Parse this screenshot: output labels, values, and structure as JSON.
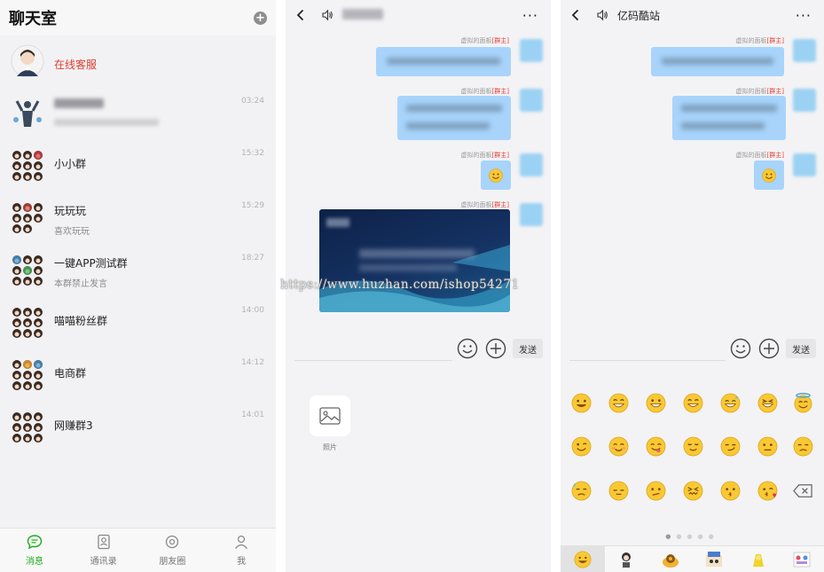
{
  "list_panel": {
    "title": "聊天室",
    "conversations": [
      {
        "name": "在线客服",
        "kind": "service"
      },
      {
        "name": "",
        "time": "03:24",
        "kind": "blurred"
      },
      {
        "name": "小小群",
        "time": "15:32",
        "kind": "group"
      },
      {
        "name": "玩玩玩",
        "time": "15:29",
        "sub": "喜欢玩玩",
        "kind": "group"
      },
      {
        "name": "一键APP测试群",
        "time": "18:27",
        "sub": "本群禁止发言",
        "kind": "group"
      },
      {
        "name": "喵喵粉丝群",
        "time": "14:00",
        "kind": "group"
      },
      {
        "name": "电商群",
        "time": "14:12",
        "kind": "group"
      },
      {
        "name": "网赚群3",
        "time": "14:01",
        "kind": "group"
      }
    ],
    "tabs": [
      {
        "label": "消息",
        "icon": "chat-bubble-icon",
        "active": true
      },
      {
        "label": "通讯录",
        "icon": "contacts-icon",
        "active": false
      },
      {
        "label": "朋友圈",
        "icon": "moments-icon",
        "active": false
      },
      {
        "label": "我",
        "icon": "person-icon",
        "active": false
      }
    ]
  },
  "chat_panel_a": {
    "title": "",
    "sender": "虚拟的面板",
    "role": "[群主]",
    "send_label": "发送",
    "tray_label": "照片"
  },
  "chat_panel_b": {
    "title": "亿码酷站",
    "sender": "虚拟的面板",
    "role": "[群主]",
    "send_label": "发送"
  },
  "watermark": "https://www.huzhan.com/ishop54271",
  "colors": {
    "accent_green": "#1aad19",
    "service_red": "#e23b2e",
    "bubble_blue": "#a8d4fb",
    "emoji_yellow": "#f9c833"
  }
}
